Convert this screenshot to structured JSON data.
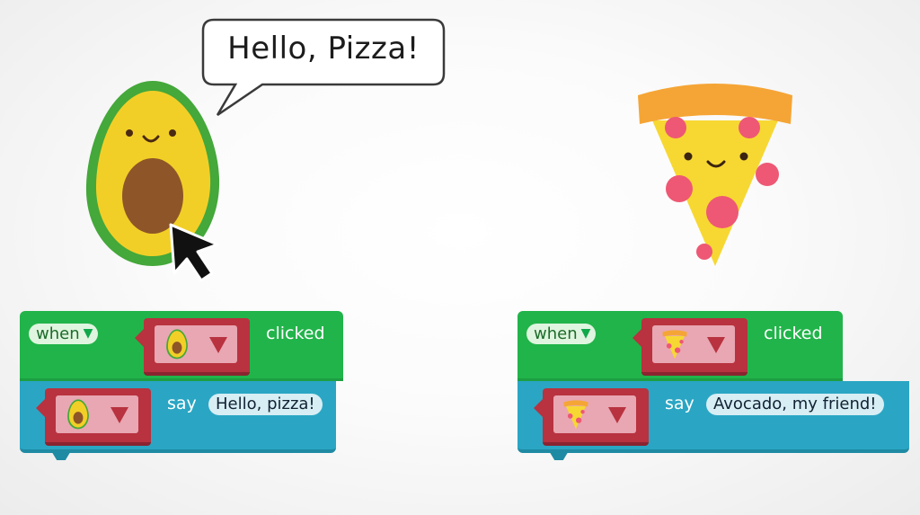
{
  "speech_bubble": {
    "text": "Hello, Pizza!"
  },
  "scripts": [
    {
      "sprite": "avocado",
      "event_block": {
        "when_label": "when",
        "event_label": "clicked"
      },
      "say_block": {
        "say_label": "say",
        "message": "Hello, pizza!"
      }
    },
    {
      "sprite": "pizza",
      "event_block": {
        "when_label": "when",
        "event_label": "clicked"
      },
      "say_block": {
        "say_label": "say",
        "message": "Avocado, my friend!"
      }
    }
  ],
  "colors": {
    "event_green": "#21b44a",
    "say_teal": "#2aa6c4",
    "say_teal_dark": "#1f8aa3",
    "sprite_menu": "#b8323f",
    "avocado_rim": "#44a83a",
    "avocado_flesh": "#f2cf27",
    "avocado_pit": "#8e5528",
    "pizza_crust": "#f5a535",
    "pizza_cheese": "#f7d832",
    "pepperoni": "#ee5874"
  },
  "icons": [
    "avocado-sprite",
    "pizza-sprite",
    "mouse-cursor-icon",
    "dropdown-arrow-icon",
    "when-dropdown-arrow-icon"
  ]
}
